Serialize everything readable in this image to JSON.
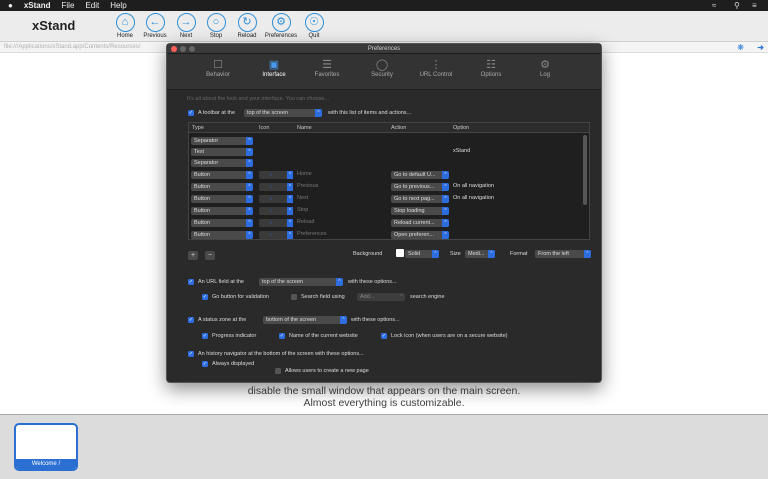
{
  "menubar": {
    "app": "xStand",
    "items": [
      "File",
      "Edit",
      "Help"
    ]
  },
  "toolbar": {
    "title": "xStand",
    "buttons": [
      {
        "label": "Home",
        "icon": "home-icon"
      },
      {
        "label": "Previous",
        "icon": "back-arrow-icon"
      },
      {
        "label": "Next",
        "icon": "forward-arrow-icon"
      },
      {
        "label": "Stop",
        "icon": "stop-icon"
      },
      {
        "label": "Reload",
        "icon": "reload-icon"
      },
      {
        "label": "Preferences",
        "icon": "gear-icon"
      },
      {
        "label": "Quit",
        "icon": "globe-icon"
      }
    ]
  },
  "urlbar": {
    "value": "file:///Applications/xStand.app/Contents/Resources/"
  },
  "welcome": {
    "line1": "disable the small window that appears on the main screen.",
    "line2": "Almost everything is customizable."
  },
  "dock": {
    "thumb_label": "Welcome /"
  },
  "prefs": {
    "title": "Preferences",
    "tabs": [
      {
        "label": "Behavior",
        "icon": "lock-icon"
      },
      {
        "label": "Interface",
        "icon": "window-icon"
      },
      {
        "label": "Favorites",
        "icon": "list-icon"
      },
      {
        "label": "Security",
        "icon": "padlock-icon"
      },
      {
        "label": "URL Control",
        "icon": "url-icon"
      },
      {
        "label": "Options",
        "icon": "options-icon"
      },
      {
        "label": "Log",
        "icon": "log-icon"
      }
    ],
    "hint": "It's all about the look and your interface. You can choose...",
    "toolbar_line": {
      "prefix": "A toolbar at the",
      "position": "top of the screen",
      "suffix": "with this list of items and actions..."
    },
    "table": {
      "headers": [
        "Type",
        "Icon",
        "Name",
        "Action",
        "Option"
      ],
      "rows": [
        {
          "type": "Separator",
          "icon": "",
          "name": "",
          "action": "",
          "option": ""
        },
        {
          "type": "Text",
          "icon": "",
          "name": "",
          "action": "",
          "option": "xStand"
        },
        {
          "type": "Separator",
          "icon": "",
          "name": "",
          "action": "",
          "option": ""
        },
        {
          "type": "Button",
          "icon": "home",
          "name": "Home",
          "action": "Go to default U...",
          "option": ""
        },
        {
          "type": "Button",
          "icon": "back",
          "name": "Previous",
          "action": "Go to previous...",
          "option": "On all navigation"
        },
        {
          "type": "Button",
          "icon": "next",
          "name": "Next",
          "action": "Go to next pag...",
          "option": "On all navigation"
        },
        {
          "type": "Button",
          "icon": "stop",
          "name": "Stop",
          "action": "Stop loading",
          "option": ""
        },
        {
          "type": "Button",
          "icon": "reload",
          "name": "Reload",
          "action": "Reload current...",
          "option": ""
        },
        {
          "type": "Button",
          "icon": "prefs",
          "name": "Preferences",
          "action": "Open preferen...",
          "option": ""
        },
        {
          "type": "Button",
          "icon": "quit",
          "name": "Quit",
          "action": "Quit",
          "option": ""
        }
      ]
    },
    "format_row": {
      "background_label": "Background",
      "background_value": "Solid",
      "size_label": "Size",
      "size_value": "Medi...",
      "format_label": "Format",
      "format_value": "From the left"
    },
    "url_field": {
      "prefix": "An URL field at the",
      "position": "top of the screen",
      "suffix": "with these options...",
      "go_button": "Go button for validation",
      "search_field": "Search field using",
      "search_value": "Add...",
      "search_suffix": "search engine"
    },
    "status_zone": {
      "prefix": "A status zone at the",
      "position": "bottom of the screen",
      "suffix": "with these options...",
      "progress": "Progress indicator",
      "name": "Name of the current website",
      "lock": "Lock icon (when users are on a secure website)"
    },
    "history": {
      "label": "An history navigator at the bottom of the screen with these options...",
      "always": "Always displayed",
      "allow_new": "Allows users to create a new page"
    }
  }
}
